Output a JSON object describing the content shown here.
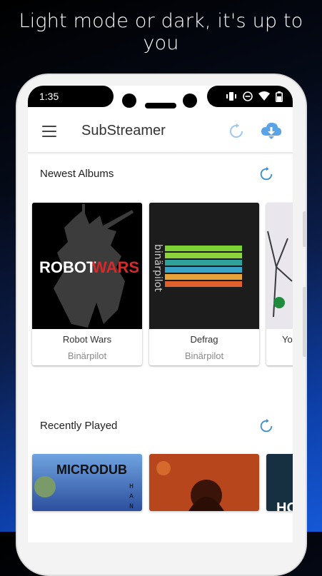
{
  "promo": {
    "headline": "Light mode or dark, it's up to you"
  },
  "status_bar": {
    "time": "1:35"
  },
  "app": {
    "title": "SubStreamer"
  },
  "icons": {
    "menu": "menu-icon",
    "refresh": "refresh-icon",
    "cloud_download": "cloud-download-icon"
  },
  "colors": {
    "accent": "#3b8fd9",
    "background": "#ffffff"
  },
  "sections": [
    {
      "title": "Newest Albums",
      "albums": [
        {
          "title": "Robot Wars",
          "artist": "Binärpilot",
          "cover_text": [
            "ROBOT",
            "WARS"
          ]
        },
        {
          "title": "Defrag",
          "artist": "Binärpilot",
          "cover_text": [
            "binärpilot"
          ]
        },
        {
          "title": "Yo",
          "artist": ""
        }
      ]
    },
    {
      "title": "Recently Played",
      "albums": [
        {
          "title": "",
          "artist": "",
          "cover_text": [
            "MICRODUB",
            "HANDE"
          ]
        },
        {
          "title": "",
          "artist": ""
        },
        {
          "title": "",
          "artist": "",
          "cover_text": [
            "HO"
          ]
        }
      ]
    }
  ]
}
